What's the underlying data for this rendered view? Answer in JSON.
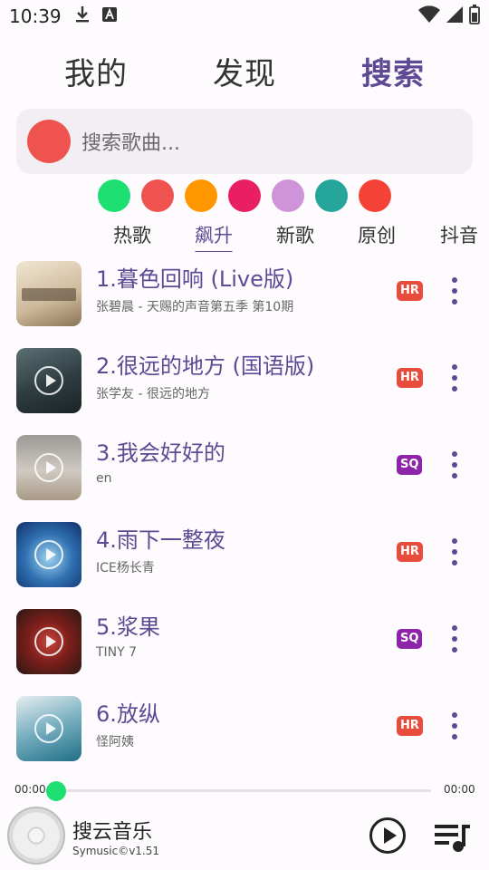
{
  "status": {
    "time": "10:39",
    "left_icons": [
      "download-icon",
      "a-icon"
    ],
    "right_icons": [
      "wifi-icon",
      "signal-icon",
      "battery-icon"
    ]
  },
  "tabs": [
    {
      "label": "我的",
      "active": false
    },
    {
      "label": "发现",
      "active": false
    },
    {
      "label": "搜索",
      "active": true
    }
  ],
  "search": {
    "placeholder": "搜索歌曲..."
  },
  "color_dots": [
    "#1ee072",
    "#ef5350",
    "#ff9800",
    "#e91e63",
    "#ce93d8",
    "#26a69a",
    "#f44336"
  ],
  "categories": [
    {
      "label": "热歌",
      "active": false
    },
    {
      "label": "飙升",
      "active": true
    },
    {
      "label": "新歌",
      "active": false
    },
    {
      "label": "原创",
      "active": false
    },
    {
      "label": "抖音",
      "active": false
    }
  ],
  "songs": [
    {
      "title": "1.暮色回响 (Live版)",
      "subtitle": "张碧晨 - 天赐的声音第五季 第10期",
      "badge": "HR"
    },
    {
      "title": "2.很远的地方 (国语版)",
      "subtitle": "张学友 - 很远的地方",
      "badge": "HR"
    },
    {
      "title": "3.我会好好的",
      "subtitle": "en",
      "badge": "SQ"
    },
    {
      "title": "4.雨下一整夜",
      "subtitle": "ICE杨长青",
      "badge": "HR"
    },
    {
      "title": "5.浆果",
      "subtitle": "TINY 7",
      "badge": "SQ"
    },
    {
      "title": "6.放纵",
      "subtitle": "怪阿姨",
      "badge": "HR"
    }
  ],
  "player": {
    "elapsed": "00:00",
    "duration": "00:00",
    "progress": 0,
    "name": "搜云音乐",
    "version": "Symusic©v1.51"
  },
  "colors": {
    "accent": "#5e4a94",
    "hr_badge": "#e74c3c",
    "sq_badge": "#8e24aa"
  }
}
